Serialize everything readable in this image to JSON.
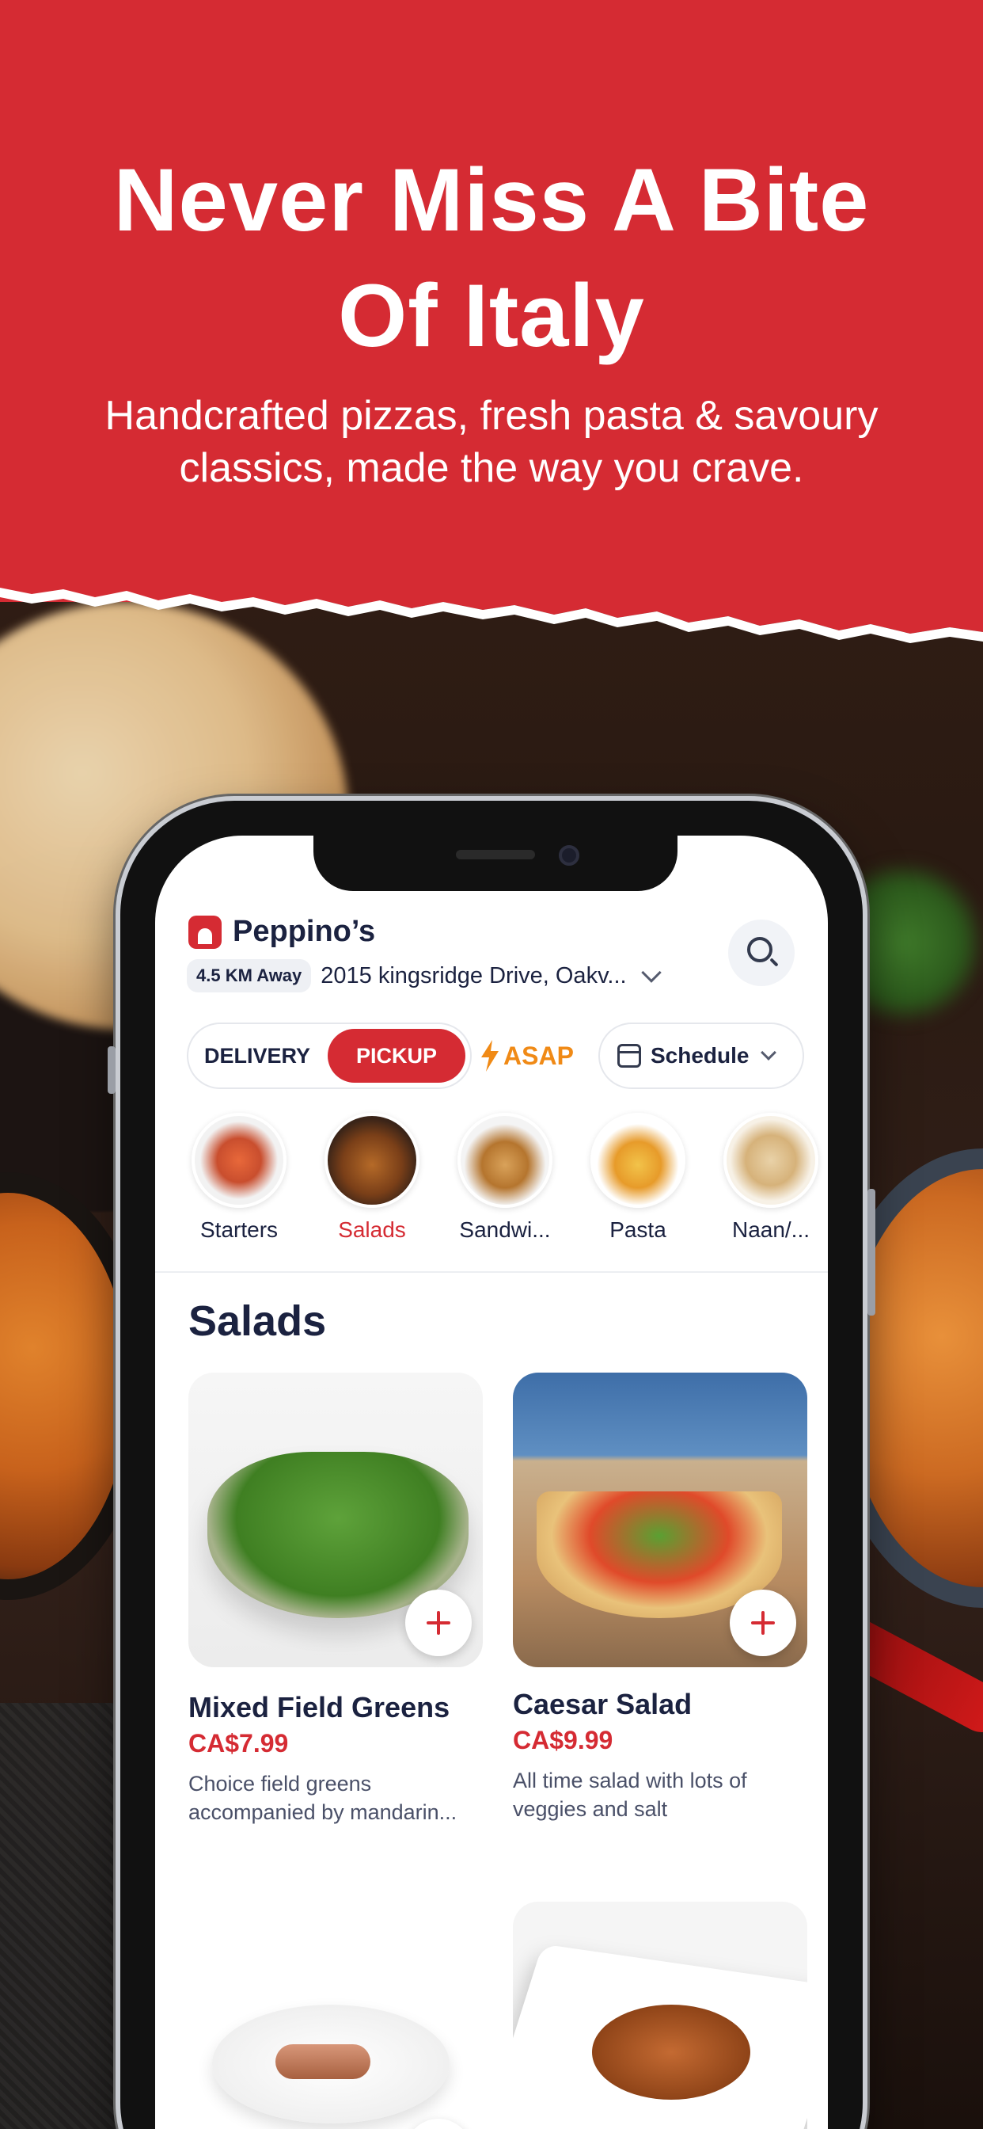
{
  "hero": {
    "title_line1": "Never Miss A Bite",
    "title_line2": "Of Italy",
    "subtitle_line1": "Handcrafted pizzas, fresh pasta & savoury",
    "subtitle_line2": "classics, made the way you crave.",
    "color": "#d52b33"
  },
  "app": {
    "restaurant_name": "Peppino’s",
    "distance_badge": "4.5 KM Away",
    "address": "2015 kingsridge Drive, Oakv...",
    "search_icon": "search-icon",
    "modes": {
      "delivery": "DELIVERY",
      "pickup": "PICKUP",
      "selected": "PICKUP"
    },
    "asap": "ASAP",
    "schedule": "Schedule",
    "categories": [
      {
        "label": "Starters",
        "active": false
      },
      {
        "label": "Salads",
        "active": true
      },
      {
        "label": "Sandwi...",
        "active": false
      },
      {
        "label": "Pasta",
        "active": false
      },
      {
        "label": "Naan/...",
        "active": false
      }
    ],
    "section_title": "Salads",
    "items": [
      {
        "name": "Mixed Field Greens",
        "price": "CA$7.99",
        "desc_line1": "Choice field greens",
        "desc_line2": "accompanied by mandarin..."
      },
      {
        "name": "Caesar Salad",
        "price": "CA$9.99",
        "desc_line1": "All time salad with lots of",
        "desc_line2": "veggies and salt"
      },
      {
        "name": "",
        "price": "",
        "desc_line1": "",
        "desc_line2": ""
      },
      {
        "name": "",
        "price": "",
        "desc_line1": "",
        "desc_line2": ""
      }
    ],
    "accent_color": "#d52b33",
    "asap_color": "#f08a16",
    "text_color": "#1b2240"
  }
}
